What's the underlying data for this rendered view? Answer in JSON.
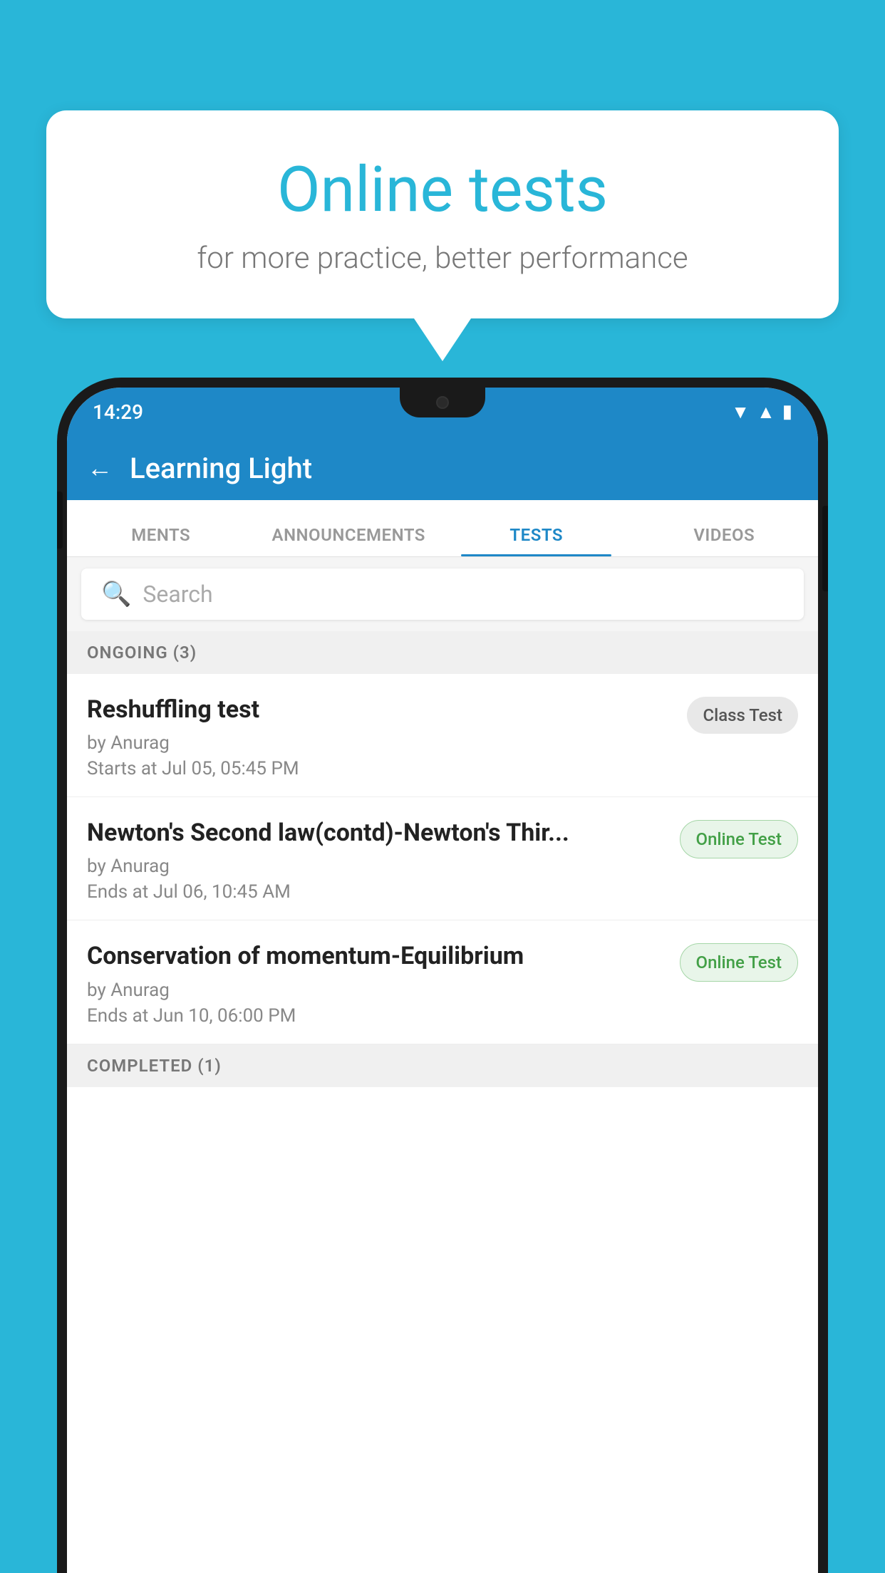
{
  "background": {
    "color": "#29b6d8"
  },
  "speech_bubble": {
    "title": "Online tests",
    "subtitle": "for more practice, better performance"
  },
  "phone": {
    "status_bar": {
      "time": "14:29",
      "icons": [
        "wifi",
        "signal",
        "battery"
      ]
    },
    "header": {
      "title": "Learning Light",
      "back_label": "←"
    },
    "tabs": [
      {
        "label": "MENTS",
        "active": false
      },
      {
        "label": "ANNOUNCEMENTS",
        "active": false
      },
      {
        "label": "TESTS",
        "active": true
      },
      {
        "label": "VIDEOS",
        "active": false
      }
    ],
    "search": {
      "placeholder": "Search"
    },
    "sections": [
      {
        "header": "ONGOING (3)",
        "items": [
          {
            "title": "Reshuffling test",
            "by": "by Anurag",
            "date": "Starts at  Jul 05, 05:45 PM",
            "badge": "Class Test",
            "badge_type": "class"
          },
          {
            "title": "Newton's Second law(contd)-Newton's Thir...",
            "by": "by Anurag",
            "date": "Ends at  Jul 06, 10:45 AM",
            "badge": "Online Test",
            "badge_type": "online"
          },
          {
            "title": "Conservation of momentum-Equilibrium",
            "by": "by Anurag",
            "date": "Ends at  Jun 10, 06:00 PM",
            "badge": "Online Test",
            "badge_type": "online"
          }
        ]
      }
    ],
    "completed_section": "COMPLETED (1)"
  }
}
